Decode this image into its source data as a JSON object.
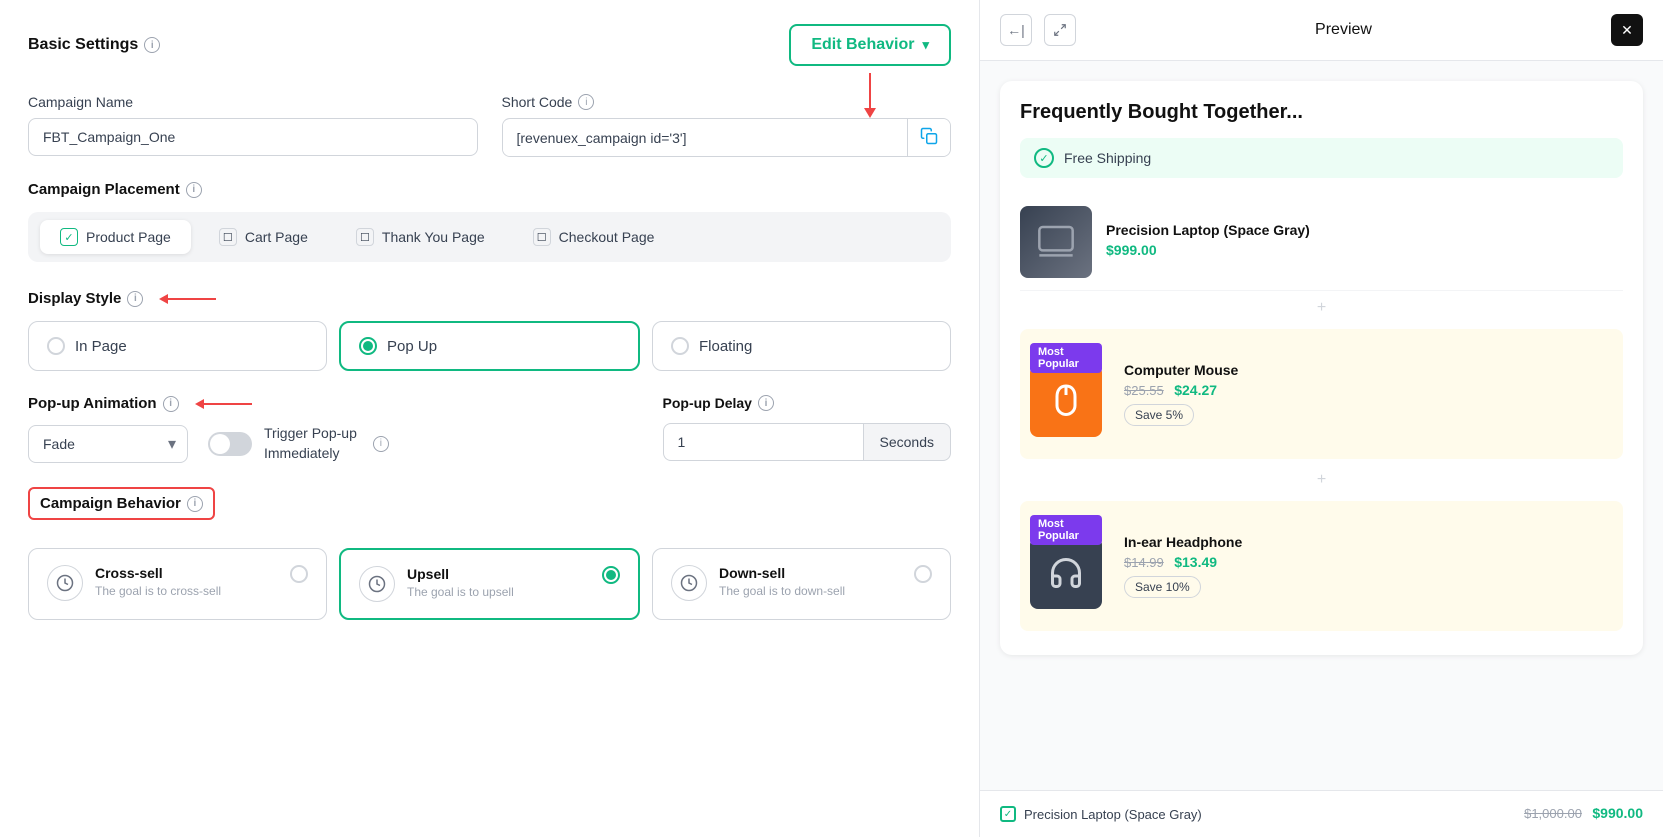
{
  "leftPanel": {
    "basicSettings": "Basic Settings",
    "editBehavior": "Edit Behavior",
    "campaignName": {
      "label": "Campaign Name",
      "value": "FBT_Campaign_One"
    },
    "shortCode": {
      "label": "Short Code",
      "value": "[revenuex_campaign id='3']"
    },
    "campaignPlacement": {
      "title": "Campaign Placement",
      "items": [
        {
          "label": "Product Page",
          "active": true
        },
        {
          "label": "Cart Page",
          "active": false
        },
        {
          "label": "Thank You Page",
          "active": false
        },
        {
          "label": "Checkout Page",
          "active": false
        }
      ]
    },
    "displayStyle": {
      "title": "Display Style",
      "options": [
        {
          "label": "In Page",
          "active": false
        },
        {
          "label": "Pop Up",
          "active": true
        },
        {
          "label": "Floating",
          "active": false
        }
      ]
    },
    "popupAnimation": {
      "title": "Pop-up Animation",
      "selectValue": "Fade",
      "triggerLabel1": "Trigger Pop-up",
      "triggerLabel2": "Immediately"
    },
    "popupDelay": {
      "title": "Pop-up Delay",
      "value": "1",
      "unit": "Seconds"
    },
    "campaignBehavior": {
      "title": "Campaign Behavior",
      "options": [
        {
          "label": "Cross-sell",
          "desc": "The goal is to cross-sell",
          "active": false
        },
        {
          "label": "Upsell",
          "desc": "The goal is to upsell",
          "active": true
        },
        {
          "label": "Down-sell",
          "desc": "The goal is to down-sell",
          "active": false
        }
      ]
    }
  },
  "rightPanel": {
    "preview": "Preview",
    "card": {
      "title": "Frequently Bought Together...",
      "freeShipping": "Free Shipping",
      "products": [
        {
          "name": "Precision Laptop (Space Gray)",
          "price": "$999.00",
          "highlighted": false,
          "popular": false
        },
        {
          "name": "Computer Mouse",
          "originalPrice": "$25.55",
          "price": "$24.27",
          "saveBadge": "Save 5%",
          "highlighted": true,
          "popular": true
        },
        {
          "name": "In-ear Headphone",
          "originalPrice": "$14.99",
          "price": "$13.49",
          "saveBadge": "Save 10%",
          "highlighted": true,
          "popular": true
        }
      ],
      "footer": {
        "productName": "Precision Laptop (Space Gray)",
        "originalPrice": "$1,000.00",
        "price": "$990.00"
      }
    }
  }
}
